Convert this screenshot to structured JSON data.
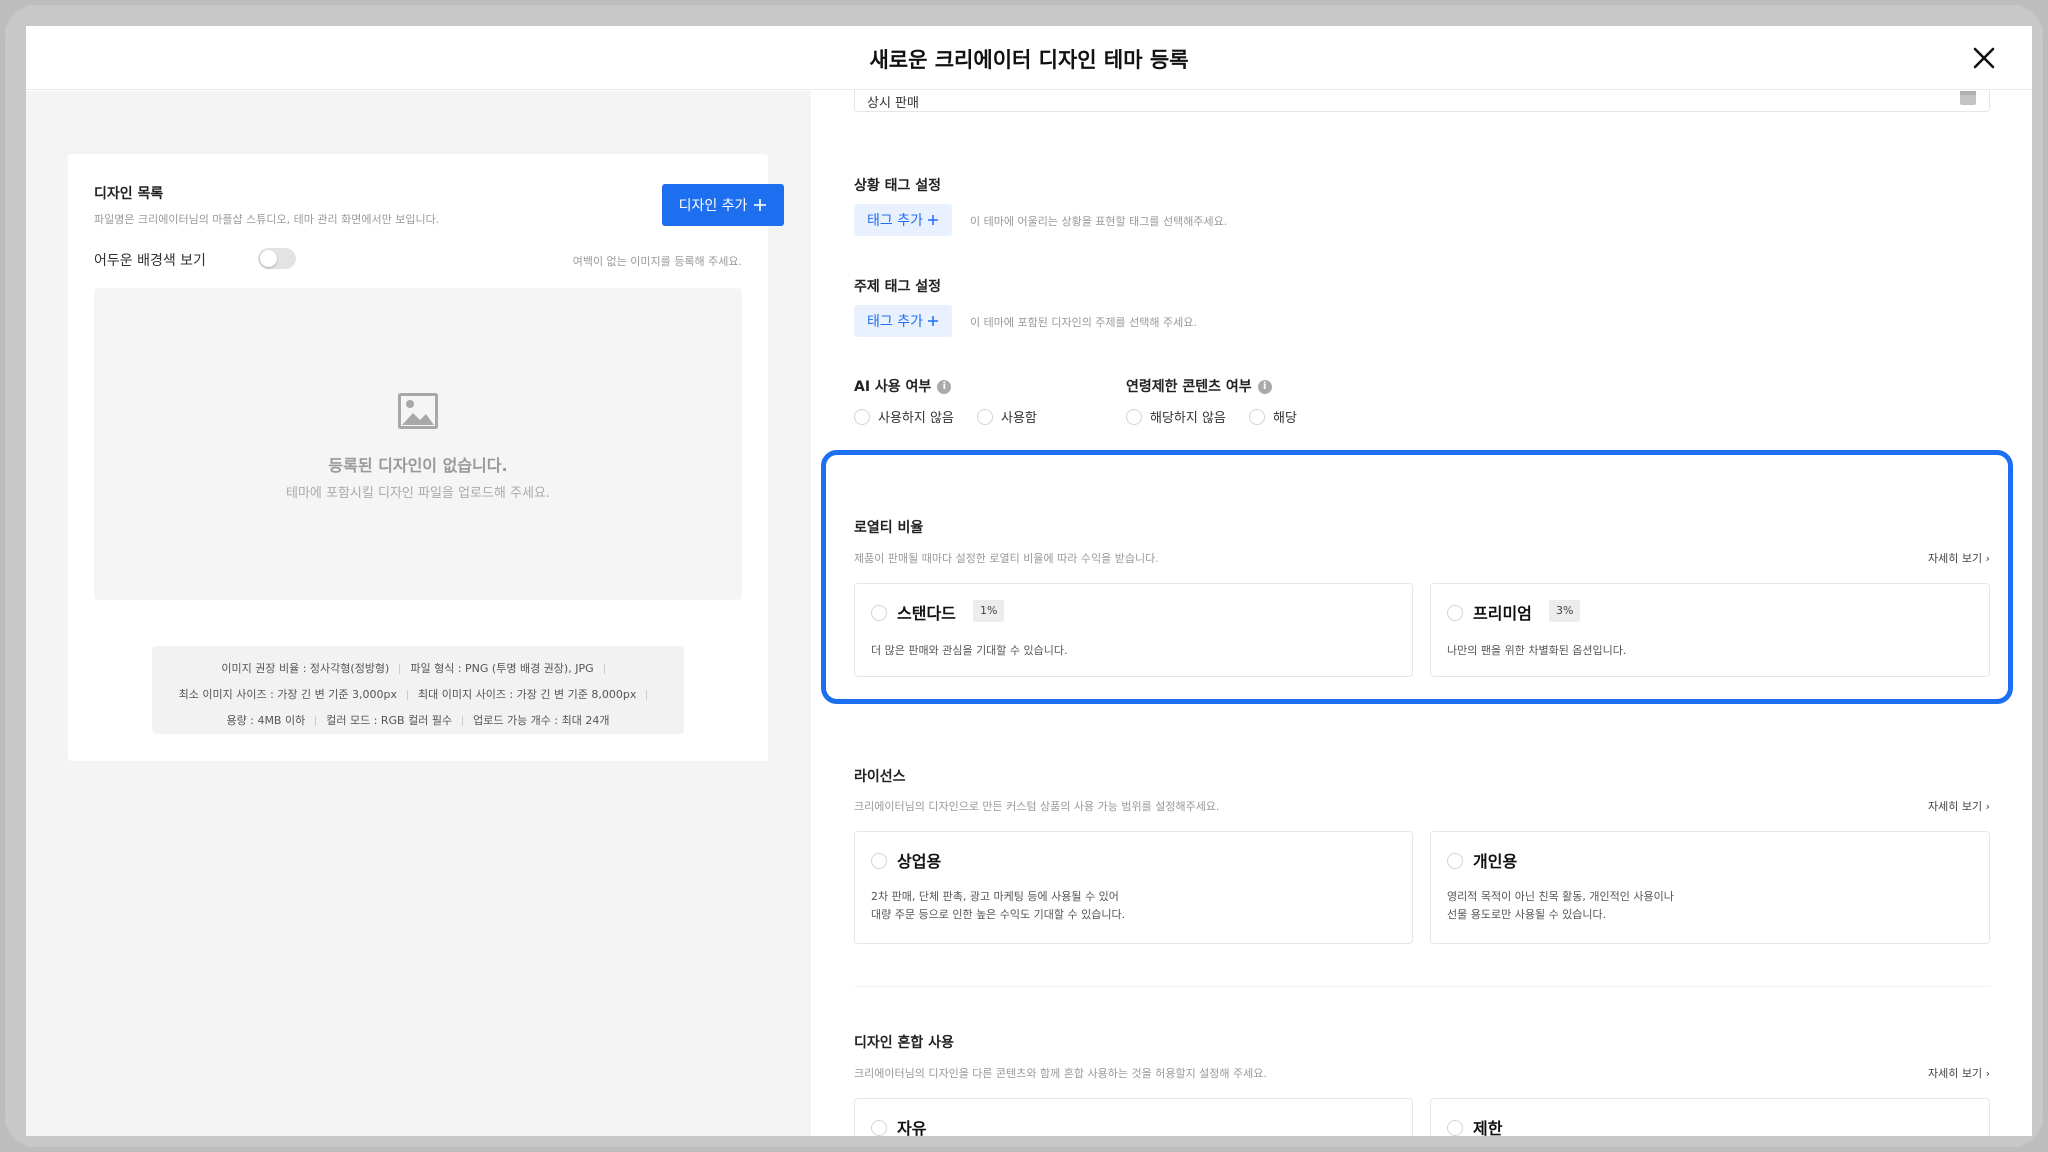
{
  "header": {
    "title": "새로운 크리에이터 디자인 테마 등록"
  },
  "left": {
    "title": "디자인 목록",
    "subtitle": "파일명은 크리에이터님의 마플샵 스튜디오, 테마 관리 화면에서만 보입니다.",
    "add_button": "디자인 추가",
    "dark_toggle_label": "어두운 배경색 보기",
    "dark_toggle_on": false,
    "right_hint": "여백이 없는 이미지를 등록해 주세요.",
    "empty_title": "등록된 디자인이 없습니다.",
    "empty_subtitle": "테마에 포함시킬 디자인 파일을 업로드해 주세요.",
    "specs": [
      [
        "이미지 권장 비율 : 정사각형(정방형)",
        "파일 형식 : PNG (투명 배경 권장), JPG"
      ],
      [
        "최소 이미지 사이즈 : 가장 긴 변 기준 3,000px",
        "최대 이미지 사이즈 : 가장 긴 변 기준 8,000px"
      ],
      [
        "용량 : 4MB 이하",
        "컬러 모드 : RGB 컬러 필수",
        "업로드 가능 개수 : 최대 24개"
      ]
    ]
  },
  "right": {
    "sale_value": "상시 판매",
    "situation_tag": {
      "title": "상황 태그 설정",
      "button": "태그 추가",
      "hint": "이 테마에 어울리는 상황을 표현할 태그를 선택해주세요."
    },
    "topic_tag": {
      "title": "주제 태그 설정",
      "button": "태그 추가",
      "hint": "이 테마에 포함된 디자인의 주제를 선택해 주세요."
    },
    "ai_use": {
      "title": "AI 사용 여부",
      "options": [
        "사용하지 않음",
        "사용함"
      ]
    },
    "age_limit": {
      "title": "연령제한 콘텐츠 여부",
      "options": [
        "해당하지 않음",
        "해당"
      ]
    },
    "royalty": {
      "title": "로열티 비율",
      "desc": "제품이 판매될 때마다 설정한 로열티 비율에 따라 수익을 받습니다.",
      "detail": "자세히 보기",
      "options": [
        {
          "title": "스탠다드",
          "badge": "1%",
          "desc": "더 많은 판매와 관심을 기대할 수 있습니다."
        },
        {
          "title": "프리미엄",
          "badge": "3%",
          "desc": "나만의 팬을 위한 차별화된 옵션입니다."
        }
      ]
    },
    "license": {
      "title": "라이선스",
      "desc": "크리에이터님의 디자인으로 만든 커스텀 상품의 사용 가능 범위를 설정해주세요.",
      "detail": "자세히 보기",
      "options": [
        {
          "title": "상업용",
          "desc1": "2차 판매, 단체 판촉, 광고 마케팅 등에 사용될 수 있어",
          "desc2": "대량 주문 등으로 인한 높은 수익도 기대할 수 있습니다."
        },
        {
          "title": "개인용",
          "desc1": "영리적 목적이 아닌 친목 활동, 개인적인 사용이나",
          "desc2": "선물 용도로만 사용될 수 있습니다."
        }
      ]
    },
    "mix": {
      "title": "디자인 혼합 사용",
      "desc": "크리에이터님의 디자인을 다른 콘텐츠와 함께 혼합 사용하는 것을 허용할지 설정해 주세요.",
      "detail": "자세히 보기",
      "options": [
        {
          "title": "자유"
        },
        {
          "title": "제한"
        }
      ]
    }
  },
  "colors": {
    "accent": "#1e6ef0",
    "highlight": "#1c6ff0"
  }
}
